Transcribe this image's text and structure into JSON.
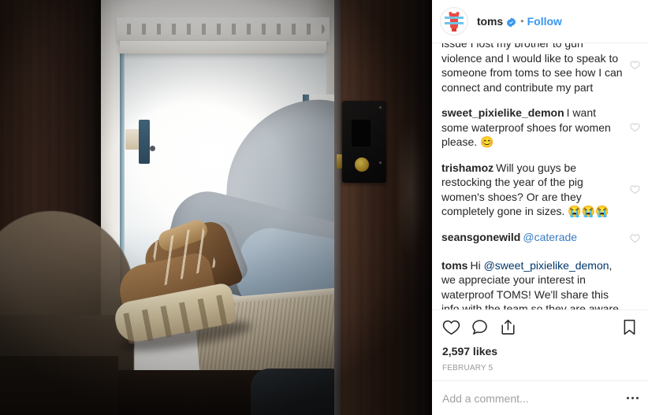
{
  "post": {
    "author": "toms",
    "verified_icon": "verified-badge-icon",
    "separator": "•",
    "follow_label": "Follow",
    "likes": "2,597 likes",
    "date": "FEBRUARY 5",
    "accent_blue": "#3897f0",
    "mention_blue": "#00376b",
    "text_color": "#262626"
  },
  "media": {
    "alt": "Person reclining with brown lug-sole boots propped on a cushion beside a bright RV window"
  },
  "comments": [
    {
      "author": "",
      "text": "issue I lost my brother to gun violence and I would like to speak to someone from toms to see how I can connect and contribute my part",
      "clipped": true
    },
    {
      "author": "sweet_pixielike_demon",
      "text": "I want some waterproof shoes for women please. 😊",
      "clipped": false
    },
    {
      "author": "trishamoz",
      "text": "Will you guys be restocking the year of the pig women's shoes? Or are they completely gone in sizes. 😭😭😭",
      "clipped": false
    },
    {
      "author": "seansgonewild",
      "mention": "@caterade",
      "text": "",
      "clipped": false
    },
    {
      "author": "toms",
      "text_before_mention": "Hi ",
      "mention": "@sweet_pixielike_demon",
      "text_after_mention": ", we appreciate your interest in waterproof TOMS! We'll share this info with the team so they are aware of the demand! Please feel free to PM (private message) us on Twitter or Facebook if you have any questions or concerns. Thank you! -Frankie",
      "clipped": false
    }
  ],
  "actions": {
    "like_icon": "heart-icon",
    "comment_icon": "comment-bubble-icon",
    "share_icon": "share-icon",
    "save_icon": "bookmark-icon"
  },
  "add_comment": {
    "placeholder": "Add a comment...",
    "value": "",
    "more_icon": "more-options-icon"
  }
}
